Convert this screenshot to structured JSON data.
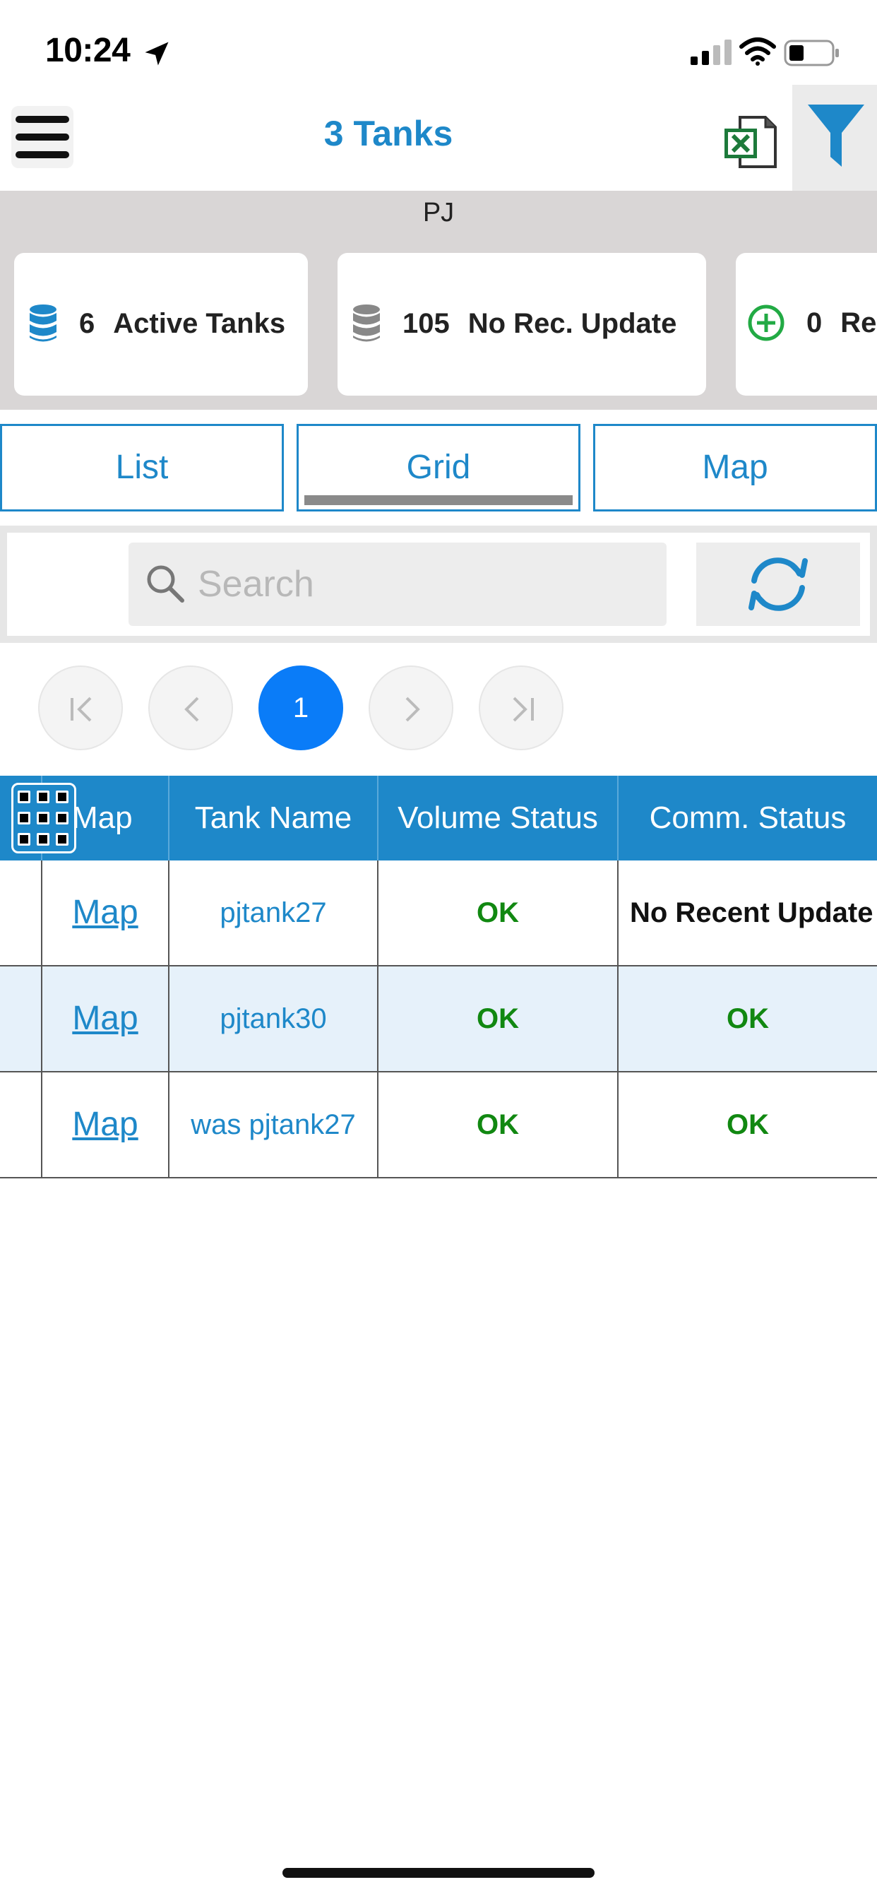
{
  "status_bar": {
    "time": "10:24"
  },
  "header": {
    "title": "3 Tanks"
  },
  "summary": {
    "group_label": "PJ",
    "cards": [
      {
        "count": "6",
        "label": "Active Tanks",
        "color": "#1e88c9"
      },
      {
        "count": "105",
        "label": "No Rec. Update",
        "color": "#888888"
      },
      {
        "count": "0",
        "label": "Re",
        "color": "#22aa44"
      }
    ]
  },
  "tabs": [
    {
      "label": "List"
    },
    {
      "label": "Grid"
    },
    {
      "label": "Map"
    }
  ],
  "search": {
    "placeholder": "Search"
  },
  "pager": {
    "current_page": "1"
  },
  "table": {
    "headers": {
      "map": "Map",
      "tank_name": "Tank Name",
      "volume_status": "Volume Status",
      "comm_status": "Comm. Status"
    },
    "rows": [
      {
        "map": "Map",
        "tank_name": "pjtank27",
        "volume_status": "OK",
        "comm_status": "No Recent Update"
      },
      {
        "map": "Map",
        "tank_name": "pjtank30",
        "volume_status": "OK",
        "comm_status": "OK"
      },
      {
        "map": "Map",
        "tank_name": "was pjtank27",
        "volume_status": "OK",
        "comm_status": "OK"
      }
    ]
  },
  "colors": {
    "accent": "#1e88c9",
    "ok": "#118811",
    "page_active": "#0a7cf8"
  }
}
